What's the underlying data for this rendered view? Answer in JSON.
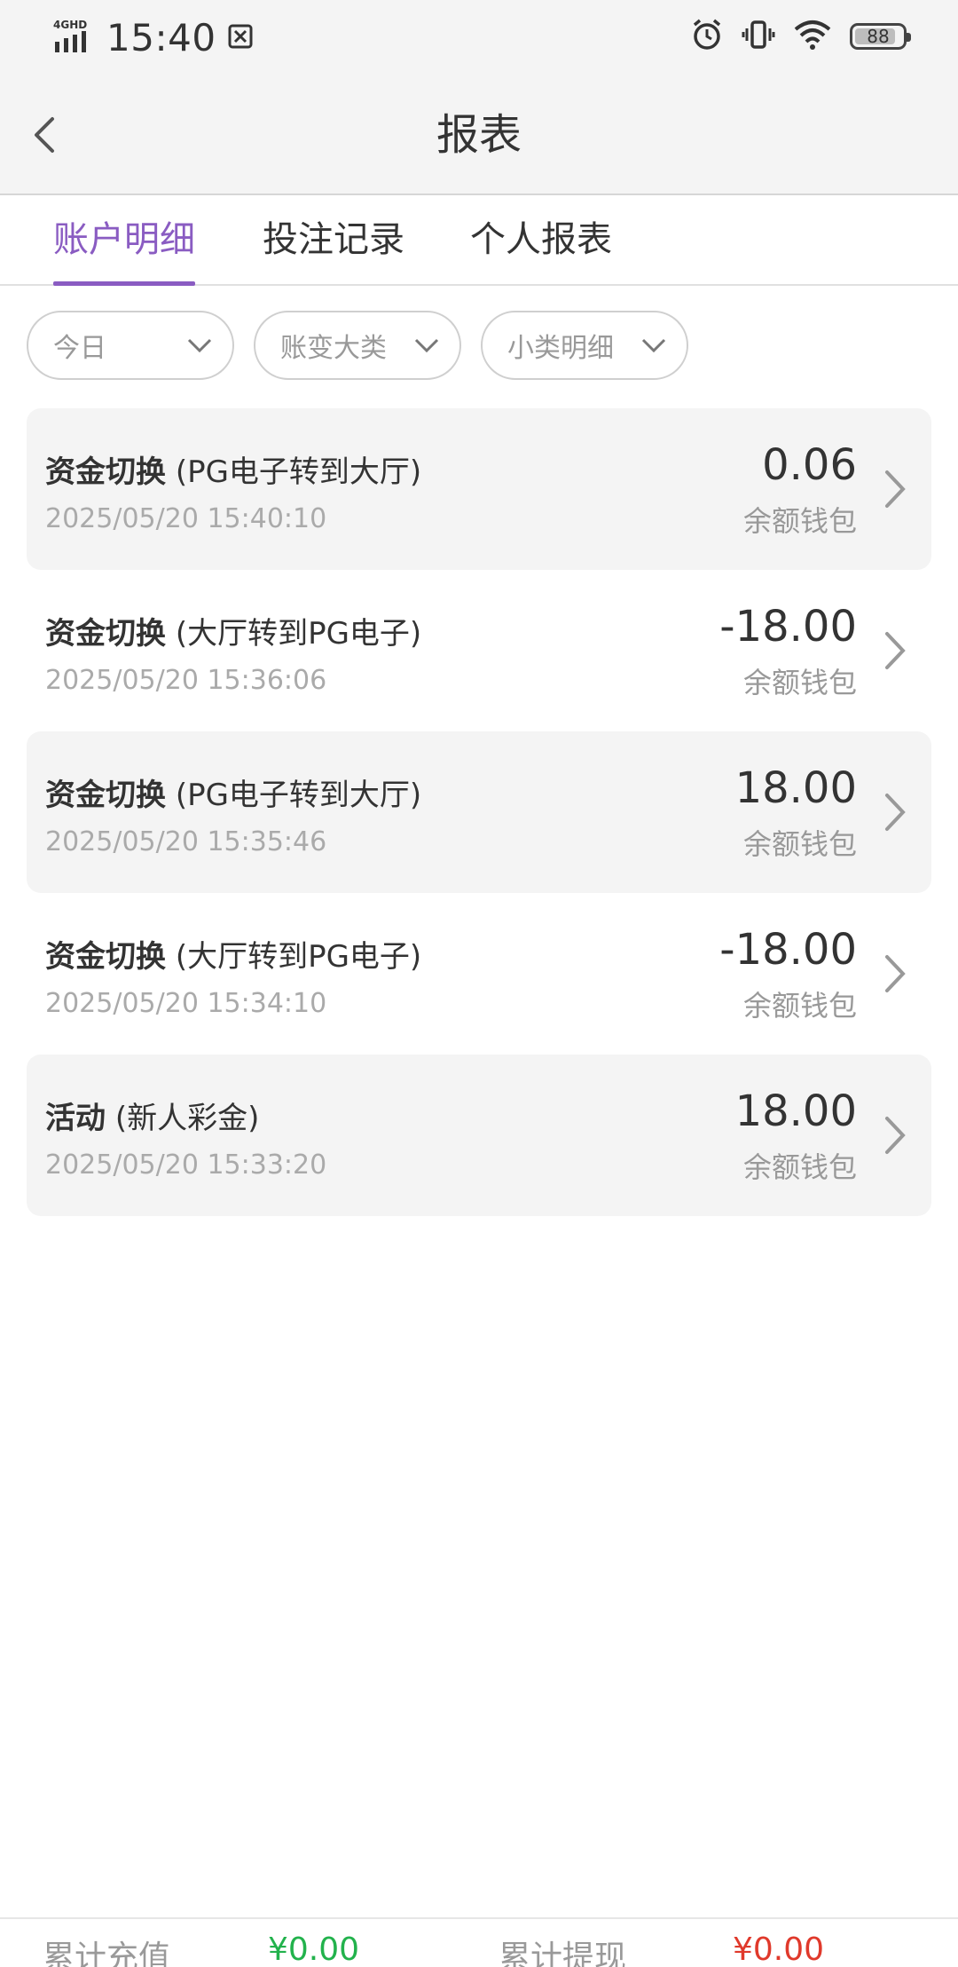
{
  "status_bar": {
    "network": "4G HD",
    "time": "15:40",
    "battery": "88"
  },
  "header": {
    "title": "报表"
  },
  "tabs": [
    {
      "label": "账户明细",
      "active": true
    },
    {
      "label": "投注记录",
      "active": false
    },
    {
      "label": "个人报表",
      "active": false
    }
  ],
  "filters": [
    {
      "label": "今日"
    },
    {
      "label": "账变大类"
    },
    {
      "label": "小类明细"
    }
  ],
  "records": [
    {
      "type": "资金切换",
      "detail": "(PG电子转到大厅)",
      "datetime": "2025/05/20 15:40:10",
      "amount": "0.06",
      "wallet": "余额钱包"
    },
    {
      "type": "资金切换",
      "detail": "(大厅转到PG电子)",
      "datetime": "2025/05/20 15:36:06",
      "amount": "-18.00",
      "wallet": "余额钱包"
    },
    {
      "type": "资金切换",
      "detail": "(PG电子转到大厅)",
      "datetime": "2025/05/20 15:35:46",
      "amount": "18.00",
      "wallet": "余额钱包"
    },
    {
      "type": "资金切换",
      "detail": "(大厅转到PG电子)",
      "datetime": "2025/05/20 15:34:10",
      "amount": "-18.00",
      "wallet": "余额钱包"
    },
    {
      "type": "活动",
      "detail": "(新人彩金)",
      "datetime": "2025/05/20 15:33:20",
      "amount": "18.00",
      "wallet": "余额钱包"
    }
  ],
  "footer": {
    "total_deposit_label": "累计充值",
    "total_deposit_value": "¥0.00",
    "total_withdraw_label": "累计提现",
    "total_withdraw_value": "¥0.00"
  },
  "colors": {
    "accent": "#8a5cc2",
    "deposit": "#22b24c",
    "withdraw": "#e0392b"
  }
}
